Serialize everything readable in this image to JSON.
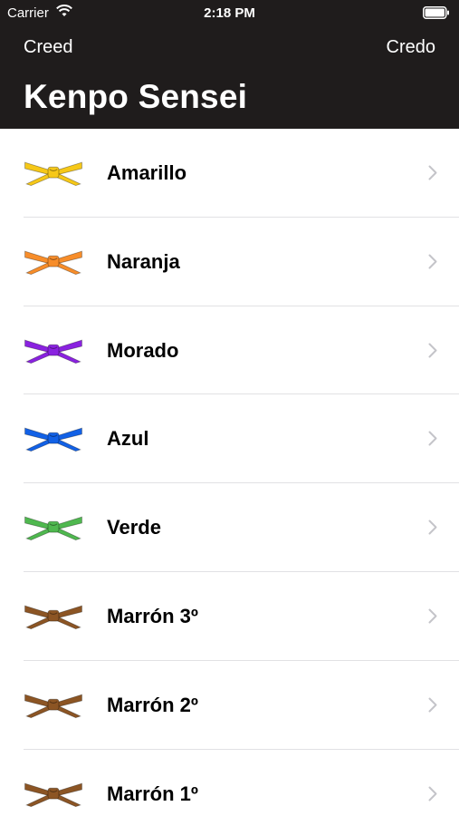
{
  "status": {
    "carrier": "Carrier",
    "time": "2:18 PM"
  },
  "nav": {
    "left_label": "Creed",
    "right_label": "Credo",
    "title": "Kenpo Sensei"
  },
  "items": [
    {
      "label": "Amarillo",
      "color": "#f6c818",
      "icon": "yellow-belt-icon"
    },
    {
      "label": "Naranja",
      "color": "#f78d2a",
      "icon": "orange-belt-icon"
    },
    {
      "label": "Morado",
      "color": "#8a22e0",
      "icon": "purple-belt-icon"
    },
    {
      "label": "Azul",
      "color": "#1261e6",
      "icon": "blue-belt-icon"
    },
    {
      "label": "Verde",
      "color": "#4fb84f",
      "icon": "green-belt-icon"
    },
    {
      "label": "Marrón 3º",
      "color": "#8c5524",
      "icon": "brown-belt-icon"
    },
    {
      "label": "Marrón 2º",
      "color": "#8c5524",
      "icon": "brown-belt-icon"
    },
    {
      "label": "Marrón 1º",
      "color": "#8c5524",
      "icon": "brown-belt-icon"
    }
  ]
}
